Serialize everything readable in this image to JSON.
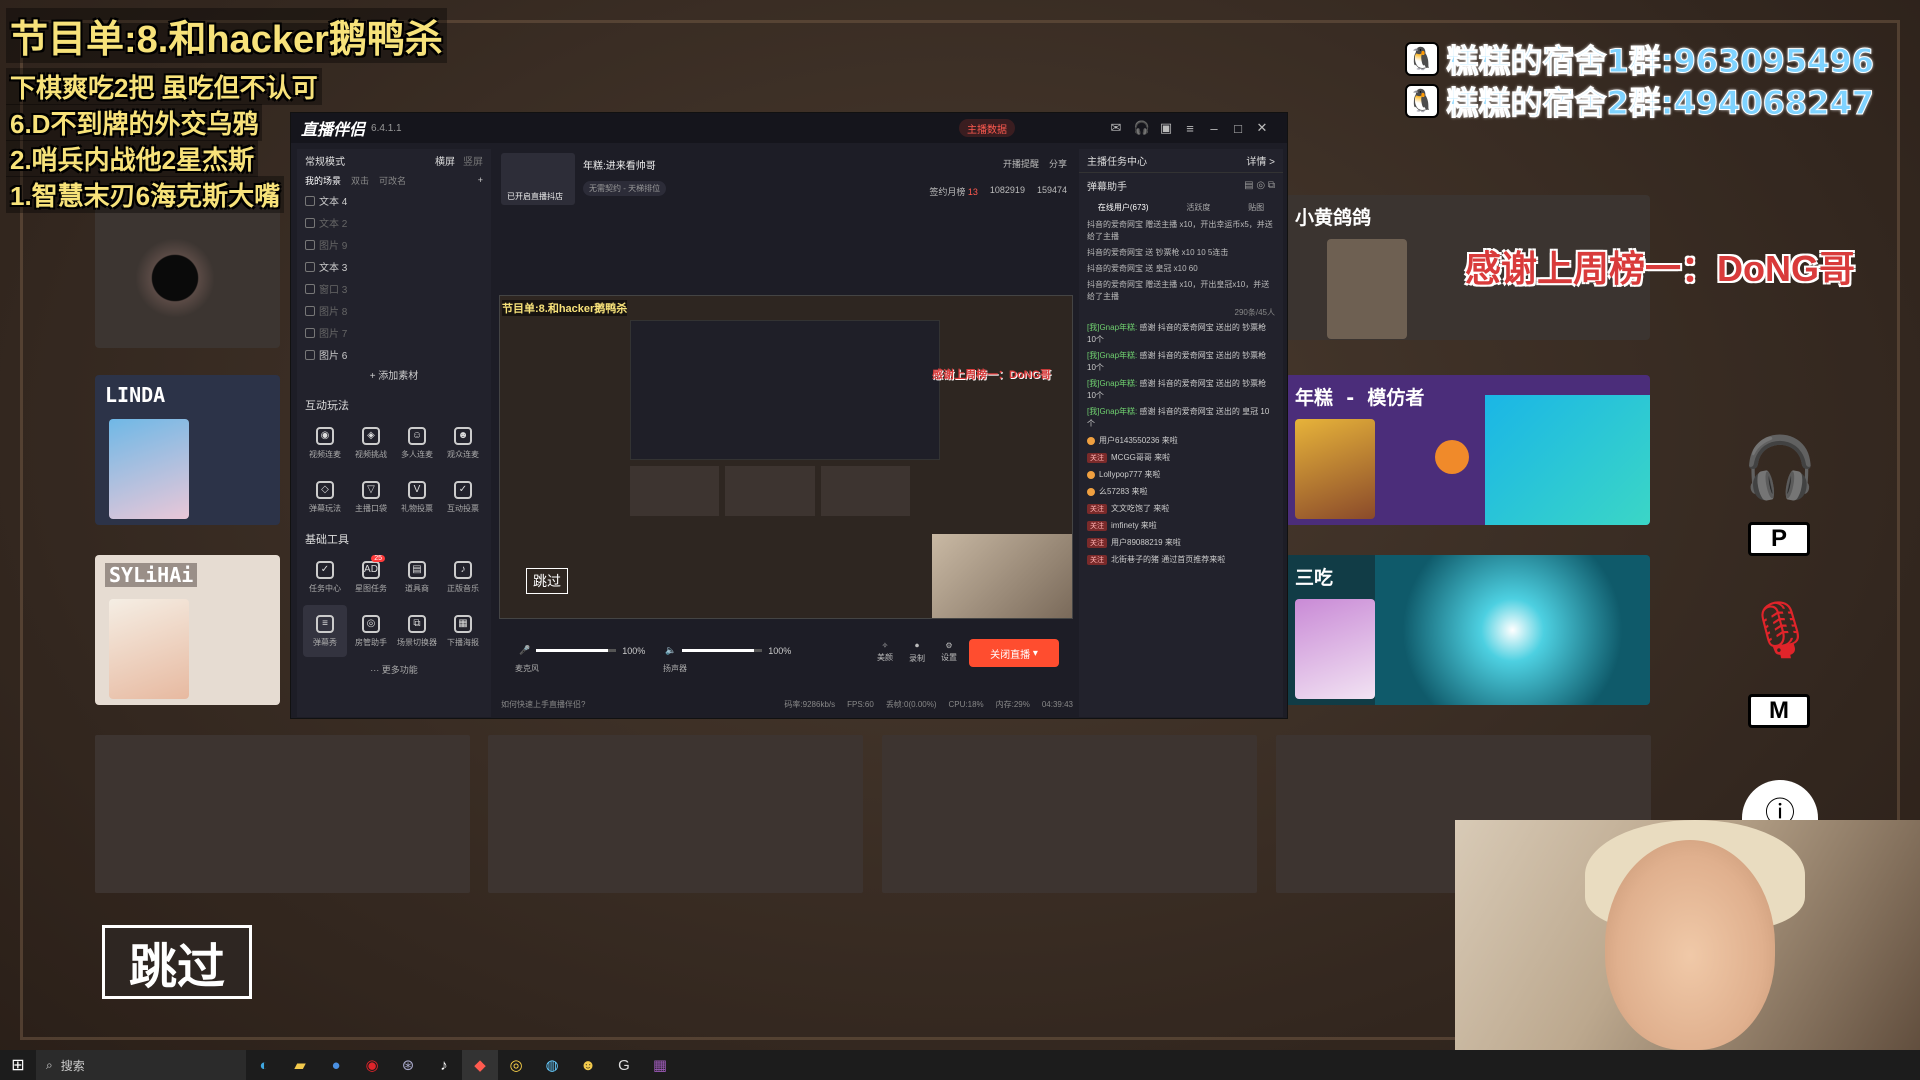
{
  "overlay": {
    "title": "节目单:8.和hacker鹅鸭杀",
    "lines": [
      "下棋爽吃2把 虽吃但不认可",
      "6.D不到牌的外交乌鸦",
      "2.哨兵内战他2星杰斯",
      "1.智慧末刃6海克斯大嘴"
    ],
    "qq_groups": [
      "糕糕的宿舍1群:963095496",
      "糕糕的宿舍2群:494068247"
    ],
    "thanks": "感谢上周榜一：DoNG哥"
  },
  "game": {
    "players": [
      {
        "name": "LINDA"
      },
      {
        "name": "SYLiHAi"
      },
      {
        "name": "小黄鸽鸽"
      },
      {
        "name": "年糕 - 模仿者"
      },
      {
        "name": "三吃"
      }
    ],
    "keys": {
      "p": "P",
      "m": "M"
    },
    "skip_label": "跳过"
  },
  "app": {
    "name": "直播伴侣",
    "version": "6.4.1.1",
    "live_data_label": "主播数据",
    "notif_count": "20",
    "left": {
      "mode_label": "常规模式",
      "landscape": "横屏",
      "portrait": "竖屏",
      "tabs": [
        "我的场景",
        "双击",
        "可改名"
      ],
      "scenes": [
        {
          "label": "文本 4",
          "dim": false
        },
        {
          "label": "文本 2",
          "dim": true
        },
        {
          "label": "图片 9",
          "dim": true
        },
        {
          "label": "文本 3",
          "dim": false
        },
        {
          "label": "窗口 3",
          "dim": true
        },
        {
          "label": "图片 8",
          "dim": true
        },
        {
          "label": "图片 7",
          "dim": true
        },
        {
          "label": "图片 6",
          "dim": false
        }
      ],
      "add_material": "+ 添加素材",
      "interactive_title": "互动玩法",
      "interactive_tools": [
        "视频连麦",
        "视频挑战",
        "多人连麦",
        "观众连麦",
        "弹幕玩法",
        "主播口袋",
        "礼物投票",
        "互动投票"
      ],
      "basic_title": "基础工具",
      "basic_tools": [
        "任务中心",
        "星图任务",
        "道具商",
        "正版音乐",
        "弹幕秀",
        "房管助手",
        "场景切换器",
        "下播海报"
      ],
      "basic_badge": "25",
      "more_label": "··· 更多功能"
    },
    "center": {
      "room_title": "年糕:进来看帅哥",
      "room_badge": "无需契约 - 天梯排位",
      "live_started": "已开启直播抖店",
      "actions": [
        "开播提醒",
        "分享"
      ],
      "stats": {
        "sign": "签约月榜",
        "sign_count": "13",
        "likes": "1082919",
        "fans": "159474"
      },
      "preview_title": "节目单:8.和hacker鹅鸭杀",
      "preview_skip": "跳过",
      "preview_thanks": "感谢上周榜一：DoNG哥",
      "mic_label": "麦克风",
      "mic_vol": "100%",
      "mic_level": 0.9,
      "speaker_label": "扬声器",
      "speaker_vol": "100%",
      "speaker_level": 0.9,
      "controls": [
        "美颜",
        "录制",
        "设置"
      ],
      "end_live": "关闭直播",
      "help": "如何快速上手直播伴侣?",
      "status": [
        "码率:9286kb/s",
        "FPS:60",
        "丢帧:0(0.00%)",
        "CPU:18%",
        "内存:29%",
        "04:39:43"
      ]
    },
    "right": {
      "task_center": "主播任务中心",
      "detail": "详情 >",
      "danmu_title": "弹幕助手",
      "tabs": [
        "在线用户(673)",
        "活跃度",
        "贴图"
      ],
      "gifts": [
        "抖音的爱奇网宝 赠送主播 x10，开出幸运币x5，并送给了主播",
        "抖音的爱奇网宝 送 钞票枪 x10  10 5连击",
        "抖音的爱奇网宝 送 皇冠 x10  60",
        "抖音的爱奇网宝 赠送主播 x10，开出皇冠x10，并送给了主播"
      ],
      "chat_count": "290条/45人",
      "chats": [
        {
          "who": "[我]Gnap年糕:",
          "text": "感谢 抖音的爱奇网宝 送出的 钞票枪 10个"
        },
        {
          "who": "[我]Gnap年糕:",
          "text": "感谢 抖音的爱奇网宝 送出的 钞票枪 10个"
        },
        {
          "who": "[我]Gnap年糕:",
          "text": "感谢 抖音的爱奇网宝 送出的 钞票枪 10个"
        },
        {
          "who": "[我]Gnap年糕:",
          "text": "感谢 抖音的爱奇网宝 送出的 皇冠 10个"
        }
      ],
      "entries": [
        {
          "tag": "",
          "text": "用户6143550236 来啦"
        },
        {
          "tag": "关注",
          "text": "MCGG哥哥 来啦"
        },
        {
          "tag": "",
          "text": "Lollypop777 来啦"
        },
        {
          "tag": "",
          "text": "么57283 来啦"
        },
        {
          "tag": "关注",
          "text": "文文吃饱了 来啦"
        },
        {
          "tag": "关注",
          "text": "imfinety 来啦"
        },
        {
          "tag": "关注",
          "text": "用户89088219 来啦"
        },
        {
          "tag": "关注",
          "text": "北街巷子的猪 通过首页推荐来啦"
        }
      ]
    }
  },
  "taskbar": {
    "search_placeholder": "搜索"
  }
}
